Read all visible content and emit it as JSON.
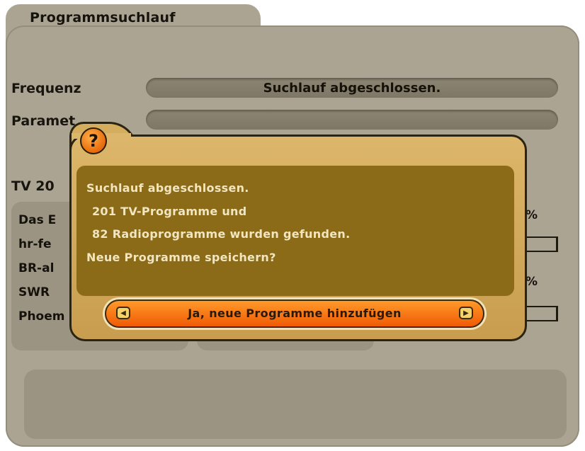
{
  "screen": {
    "title": "Programmsuchlauf",
    "frequency_label": "Frequenz",
    "frequency_value": "Suchlauf abgeschlossen.",
    "parameter_label": "Paramet",
    "tv_label": "TV",
    "tv_count": "20",
    "tv_list": [
      "Das E",
      "hr-fe",
      "BR-al",
      "SWR",
      "Phoem"
    ],
    "percent_sign_1": "%",
    "percent_sign_2": "%"
  },
  "dialog": {
    "icon": "question-icon",
    "icon_glyph": "?",
    "message_lines": [
      "Suchlauf abgeschlossen.",
      "201 TV-Programme und",
      "82 Radioprogramme wurden gefunden.",
      "Neue Programme speichern?"
    ],
    "button_label": "Ja, neue Programme hinzufügen",
    "left_arrow": "◀",
    "right_arrow": "▶"
  },
  "colors": {
    "panel": "#aca493",
    "dialog": "#d4ad5f",
    "message_box": "#8b6a18",
    "button": "#f36a10"
  }
}
